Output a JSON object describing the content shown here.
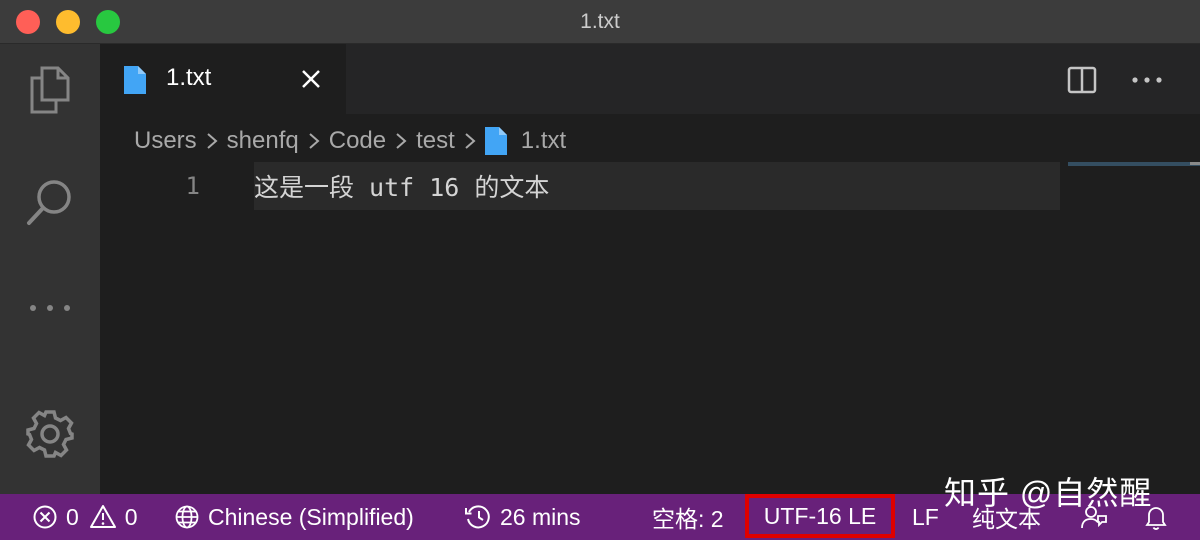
{
  "window": {
    "title": "1.txt"
  },
  "tab": {
    "label": "1.txt"
  },
  "breadcrumb": {
    "segments": [
      "Users",
      "shenfq",
      "Code",
      "test"
    ],
    "file": "1.txt"
  },
  "editor": {
    "line_number": "1",
    "line_text": "这是一段 utf 16 的文本"
  },
  "statusbar": {
    "errors": "0",
    "warnings": "0",
    "language_pack": "Chinese (Simplified)",
    "time": "26 mins",
    "indent": "空格: 2",
    "encoding": "UTF-16 LE",
    "eol": "LF",
    "mode": "纯文本"
  },
  "watermark": "知乎 @自然醒",
  "colors": {
    "statusbar": "#68217a",
    "highlight_box": "#e00000",
    "file_icon": "#42a5f5"
  }
}
